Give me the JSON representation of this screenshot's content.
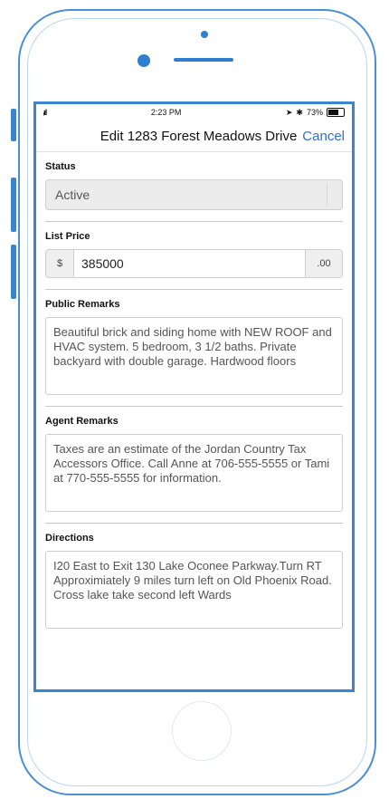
{
  "status_bar": {
    "signal": "ᵢıl",
    "time": "2:23 PM",
    "battery_text": "73%"
  },
  "nav": {
    "title": "Edit 1283 Forest Meadows Drive",
    "cancel": "Cancel"
  },
  "status": {
    "label": "Status",
    "value": "Active"
  },
  "list_price": {
    "label": "List Price",
    "prefix": "$",
    "value": "385000",
    "suffix": ".00"
  },
  "public_remarks": {
    "label": "Public Remarks",
    "value": "Beautiful brick and siding home with NEW ROOF and HVAC system. 5 bedroom, 3 1/2 baths. Private backyard with double garage. Hardwood floors"
  },
  "agent_remarks": {
    "label": "Agent Remarks",
    "value": "Taxes are an estimate of the Jordan Country Tax Accessors Office. Call Anne at 706-555-5555 or Tami at 770-555-5555 for information."
  },
  "directions": {
    "label": "Directions",
    "value": "I20 East to Exit 130 Lake Oconee Parkway.Turn RT Approximiately 9 miles turn left on Old Phoenix Road. Cross lake take second left Wards"
  },
  "colors": {
    "frame": "#4a8fd6",
    "accent": "#2f6fd0"
  }
}
